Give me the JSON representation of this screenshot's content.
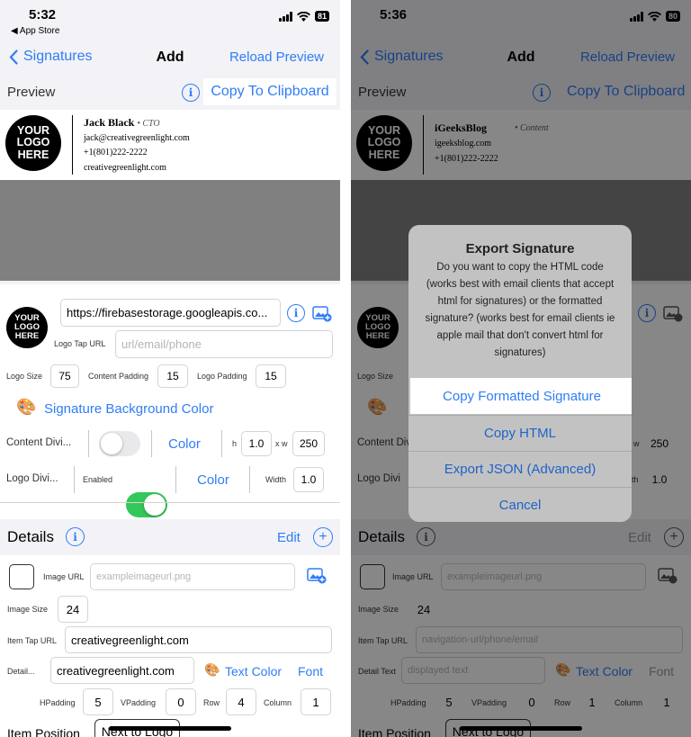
{
  "left": {
    "status": {
      "time": "5:32",
      "back_app": "◀ App Store",
      "battery": "81"
    },
    "nav": {
      "back_label": "Signatures",
      "title": "Add",
      "reload": "Reload Preview"
    },
    "preview": {
      "label": "Preview",
      "copy": "Copy To Clipboard"
    },
    "signature": {
      "logo_lines": [
        "YOUR",
        "LOGO",
        "HERE"
      ],
      "name": "Jack Black",
      "role": "• CTO",
      "email": "jack@creativegreenlight.com",
      "phone": "+1(801)222-2222",
      "website": "creativegreenlight.com"
    },
    "form": {
      "logo_url": "https://firebasestorage.googleapis.co...",
      "logo_tap_label": "Logo Tap URL",
      "logo_tap_placeholder": "url/email/phone",
      "logo_size_label": "Logo Size",
      "logo_size": "75",
      "content_padding_label": "Content Padding",
      "content_padding": "15",
      "logo_padding_label": "Logo Padding",
      "logo_padding": "15",
      "bg_color": "Signature Background Color",
      "content_divider_label": "Content Divi...",
      "color_label": "Color",
      "h_label": "h",
      "h_value": "1.0",
      "w_label": "x w",
      "w_value": "250",
      "logo_divider_label": "Logo Divi...",
      "enabled_label": "Enabled",
      "width_label": "Width",
      "width_value": "1.0"
    },
    "details": {
      "label": "Details",
      "edit": "Edit",
      "image_url_label": "Image URL",
      "image_url_placeholder": "exampleimageurl.png",
      "image_size_label": "Image Size",
      "image_size": "24",
      "item_tap_label": "Item Tap URL",
      "item_tap_value": "creativegreenlight.com",
      "detail_label": "Detail...",
      "detail_value": "creativegreenlight.com",
      "text_color": "Text Color",
      "font": "Font",
      "hpadding_label": "HPadding",
      "hpadding": "5",
      "vpadding_label": "VPadding",
      "vpadding": "0",
      "row_label": "Row",
      "row": "4",
      "column_label": "Column",
      "column": "1",
      "item_position_label": "Item Position",
      "item_position": "Next to Logo"
    }
  },
  "right": {
    "status": {
      "time": "5:36",
      "battery": "80"
    },
    "nav": {
      "back_label": "Signatures",
      "title": "Add",
      "reload": "Reload Preview"
    },
    "preview": {
      "label": "Preview",
      "copy": "Copy To Clipboard"
    },
    "signature": {
      "logo_lines": [
        "YOUR",
        "LOGO",
        "HERE"
      ],
      "name": "iGeeksBlog",
      "role": "• Content",
      "website": "igeeksblog.com",
      "phone": "+1(801)222-2222"
    },
    "form": {
      "logo_size_label": "Logo Size",
      "content_divider_label": "Content Divi",
      "w_label": "w",
      "w_value": "250",
      "logo_divider_label": "Logo Divi",
      "width_label": "th",
      "width_value": "1.0"
    },
    "details": {
      "label": "Details",
      "edit": "Edit",
      "image_url_label": "Image URL",
      "image_url_placeholder": "exampleimageurl.png",
      "image_size_label": "Image Size",
      "image_size": "24",
      "item_tap_label": "Item Tap URL",
      "item_tap_placeholder": "navigation-url/phone/email",
      "detail_label": "Detail Text",
      "detail_placeholder": "displayed text",
      "text_color": "Text Color",
      "font": "Font",
      "hpadding_label": "HPadding",
      "hpadding": "5",
      "vpadding_label": "VPadding",
      "vpadding": "0",
      "row_label": "Row",
      "row": "1",
      "column_label": "Column",
      "column": "1",
      "item_position_label": "Item Position",
      "item_position": "Next to Logo"
    },
    "alert": {
      "title": "Export Signature",
      "message": "Do you want to copy the HTML code (works best with email clients that accept html for signatures) or the formatted signature? (works best for email clients ie apple mail that don't convert html for signatures)",
      "buttons": [
        "Copy Formatted Signature",
        "Copy HTML",
        "Export JSON (Advanced)",
        "Cancel"
      ]
    }
  },
  "colors": {
    "accent": "#2f7df6",
    "toggle_on": "#34c759",
    "background": "#f2f2f7"
  }
}
